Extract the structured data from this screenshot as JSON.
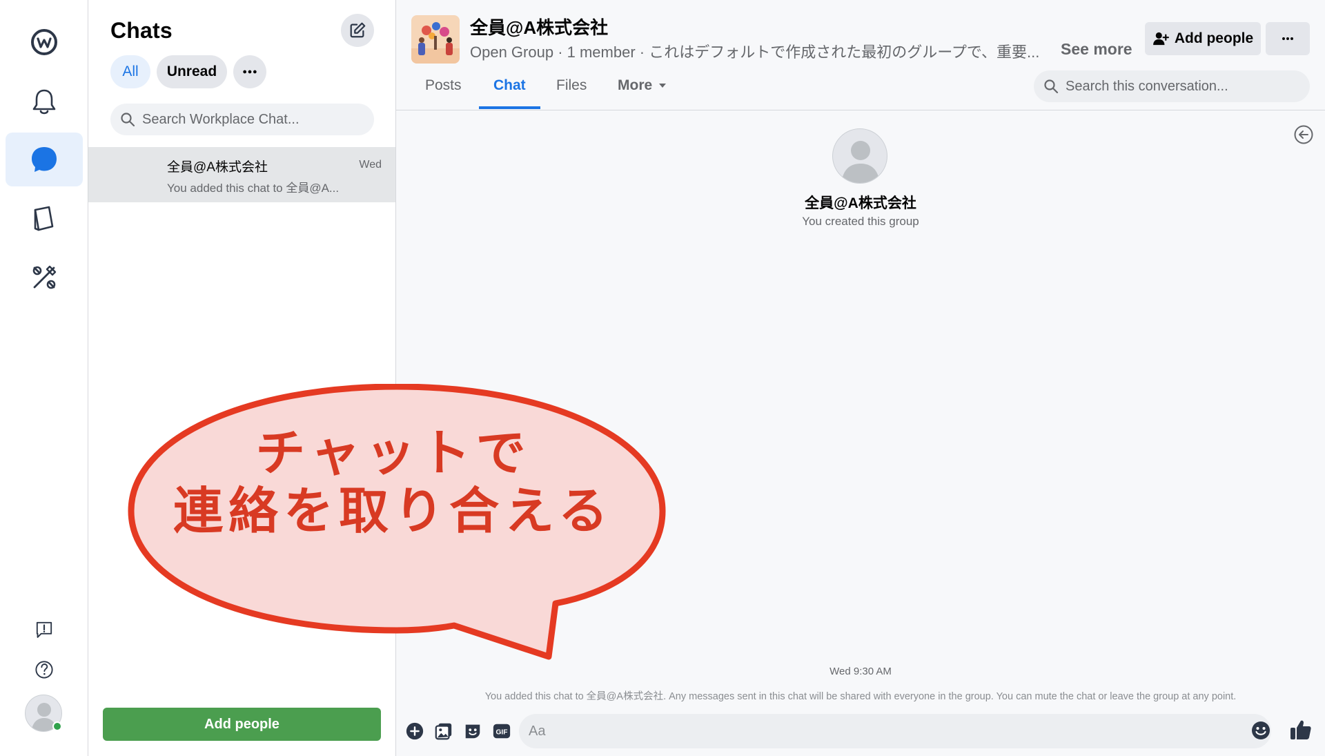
{
  "rail": {
    "items": [
      {
        "name": "workplace-logo",
        "icon": "workplace-logo-icon"
      },
      {
        "name": "notifications",
        "icon": "bell-icon"
      },
      {
        "name": "chats",
        "icon": "chat-bubble-icon",
        "active": true
      },
      {
        "name": "knowledge-library",
        "icon": "book-icon"
      },
      {
        "name": "tools",
        "icon": "tools-icon"
      }
    ],
    "bottom": [
      {
        "name": "feedback",
        "icon": "feedback-icon"
      },
      {
        "name": "help",
        "icon": "help-icon"
      }
    ]
  },
  "list": {
    "title": "Chats",
    "filters": {
      "all": "All",
      "unread": "Unread"
    },
    "search_placeholder": "Search Workplace Chat...",
    "chats": [
      {
        "name": "全員@A株式会社",
        "time": "Wed",
        "preview": "You added this chat to 全員@A..."
      }
    ],
    "add_people_label": "Add people"
  },
  "conversation": {
    "title": "全員@A株式会社",
    "subtitle": "Open Group · 1 member · これはデフォルトで作成された最初のグループで、重要...",
    "see_more": "See more",
    "add_people_label": "Add people",
    "tabs": {
      "posts": "Posts",
      "chat": "Chat",
      "files": "Files",
      "more": "More"
    },
    "active_tab": "Chat",
    "search_placeholder": "Search this conversation...",
    "intro_name": "全員@A株式会社",
    "intro_text": "You created this group",
    "timestamp": "Wed 9:30 AM",
    "system_message": "You added this chat to 全員@A株式会社. Any messages sent in this chat will be shared with everyone in the group. You can mute the chat or leave the group at any point.",
    "composer_placeholder": "Aa"
  },
  "callout": {
    "line1": "チャットで",
    "line2": "連絡を取り合える",
    "fill_color": "#f9d9d7",
    "stroke_color": "#e53a22"
  },
  "colors": {
    "accent": "#1b74e4",
    "green_button": "#4b9e4f",
    "online": "#31a24c"
  }
}
